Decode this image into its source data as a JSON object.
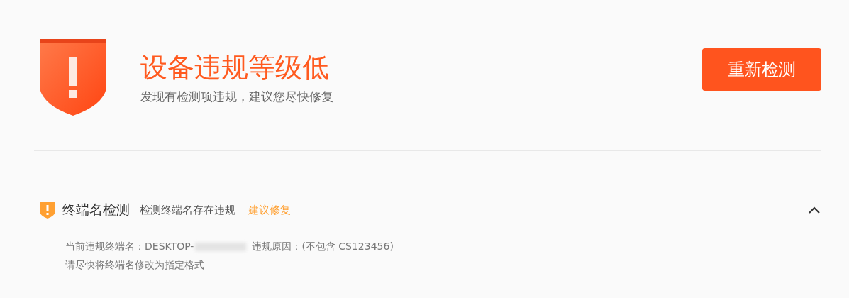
{
  "summary": {
    "title": "设备违规等级低",
    "subtitle": "发现有检测项违规，建议您尽快修复",
    "button": "重新检测"
  },
  "checks": [
    {
      "title": "终端名检测",
      "description": "检测终端名存在违规",
      "action": "建议修复",
      "expanded": true,
      "details": [
        {
          "kind": "redacted",
          "before": "当前违规终端名：DESKTOP-",
          "after": "违规原因：(不包含 CS123456)"
        },
        {
          "kind": "text",
          "text": "请尽快将终端名修改为指定格式"
        }
      ]
    }
  ]
}
